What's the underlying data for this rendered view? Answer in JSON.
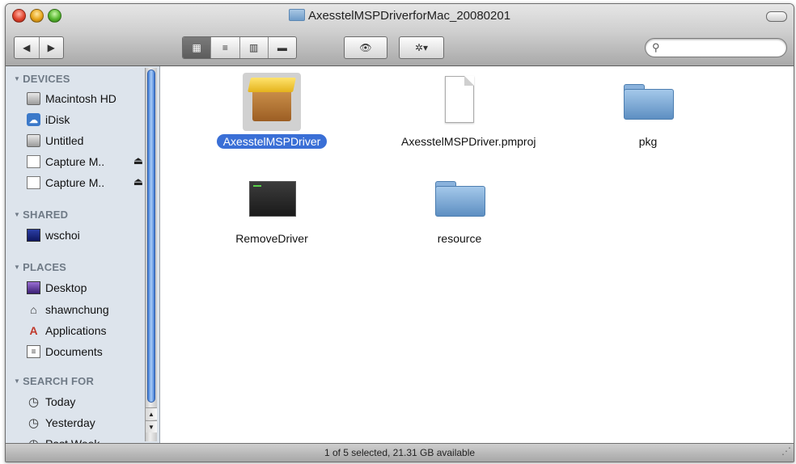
{
  "window": {
    "title": "AxesstelMSPDriverforMac_20080201",
    "status": "1 of 5 selected, 21.31 GB available"
  },
  "toolbar": {
    "back_icon": "◀",
    "forward_icon": "▶",
    "view_icon_label": "▦",
    "view_list_label": "≡",
    "view_column_label": "▥",
    "view_coverflow_label": "▬",
    "quicklook_label": "👁",
    "action_label": "✲▾",
    "search_placeholder": "",
    "search_icon": "⚲"
  },
  "sidebar": {
    "devices_label": "DEVICES",
    "shared_label": "SHARED",
    "places_label": "PLACES",
    "search_for_label": "SEARCH FOR",
    "devices": [
      {
        "label": "Macintosh HD",
        "icon": "hard-drive-icon"
      },
      {
        "label": "iDisk",
        "icon": "idisk-icon"
      },
      {
        "label": "Untitled",
        "icon": "hard-drive-icon"
      },
      {
        "label": "Capture M..",
        "icon": "disk-image-icon",
        "eject": "⏏"
      },
      {
        "label": "Capture M..",
        "icon": "disk-image-icon",
        "eject": "⏏"
      }
    ],
    "shared": [
      {
        "label": "wschoi",
        "icon": "network-computer-icon"
      }
    ],
    "places": [
      {
        "label": "Desktop",
        "icon": "desktop-icon"
      },
      {
        "label": "shawnchung",
        "icon": "home-icon"
      },
      {
        "label": "Applications",
        "icon": "applications-icon"
      },
      {
        "label": "Documents",
        "icon": "documents-icon"
      }
    ],
    "search_for": [
      {
        "label": "Today",
        "icon": "clock-icon"
      },
      {
        "label": "Yesterday",
        "icon": "clock-icon"
      },
      {
        "label": "Past Week",
        "icon": "clock-icon"
      }
    ]
  },
  "files": [
    {
      "name": "AxesstelMSPDriver",
      "type": "package",
      "selected": true
    },
    {
      "name": "AxesstelMSPDriver.pmproj",
      "type": "document",
      "selected": false
    },
    {
      "name": "pkg",
      "type": "folder",
      "selected": false
    },
    {
      "name": "RemoveDriver",
      "type": "terminal-script",
      "selected": false
    },
    {
      "name": "resource",
      "type": "folder",
      "selected": false
    }
  ]
}
